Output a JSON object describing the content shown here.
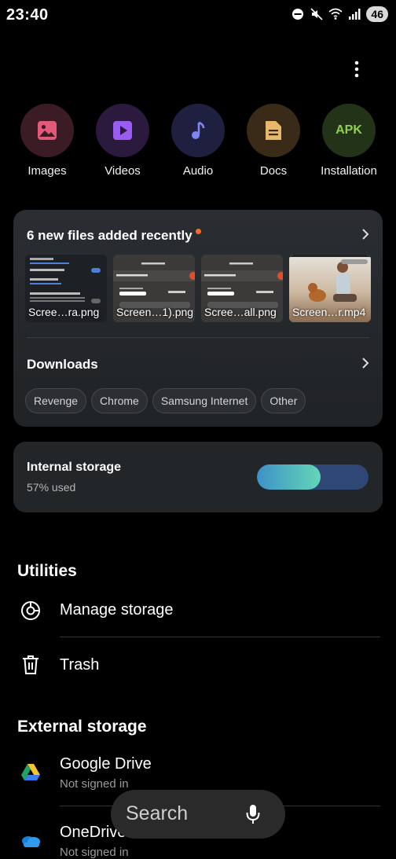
{
  "status": {
    "time": "23:40",
    "battery": "46"
  },
  "categories": [
    {
      "label": "Images",
      "icon": "images-icon",
      "color": "#e25a7a",
      "bg": "#3b1c24"
    },
    {
      "label": "Videos",
      "icon": "videos-icon",
      "color": "#9b5cf0",
      "bg": "#2b1a3d"
    },
    {
      "label": "Audio",
      "icon": "audio-icon",
      "color": "#7d86f2",
      "bg": "#1f2040"
    },
    {
      "label": "Docs",
      "icon": "docs-icon",
      "color": "#e8b86a",
      "bg": "#3a2a18"
    },
    {
      "label": "Installation",
      "icon": "apk-icon",
      "badge": "APK",
      "color": "#8fd14f",
      "bg": "#233318"
    }
  ],
  "recent": {
    "title": "6 new files added recently",
    "files": [
      {
        "name": "Scree…ra.png"
      },
      {
        "name": "Screen…1).png"
      },
      {
        "name": "Scree…all.png"
      },
      {
        "name": "Screen…r.mp4"
      }
    ]
  },
  "downloads": {
    "title": "Downloads",
    "chips": [
      "Revenge",
      "Chrome",
      "Samsung Internet",
      "Other"
    ]
  },
  "storage": {
    "title": "Internal storage",
    "used_text": "57% used",
    "used_fraction": 0.57
  },
  "utilities": {
    "title": "Utilities",
    "items": [
      {
        "label": "Manage storage",
        "icon": "storage-chart-icon"
      },
      {
        "label": "Trash",
        "icon": "trash-icon"
      }
    ]
  },
  "external": {
    "title": "External storage",
    "items": [
      {
        "label": "Google Drive",
        "sub": "Not signed in",
        "icon": "google-drive-icon"
      },
      {
        "label": "OneDrive",
        "sub": "Not signed in",
        "icon": "onedrive-icon"
      }
    ]
  },
  "search": {
    "label": "Search"
  }
}
